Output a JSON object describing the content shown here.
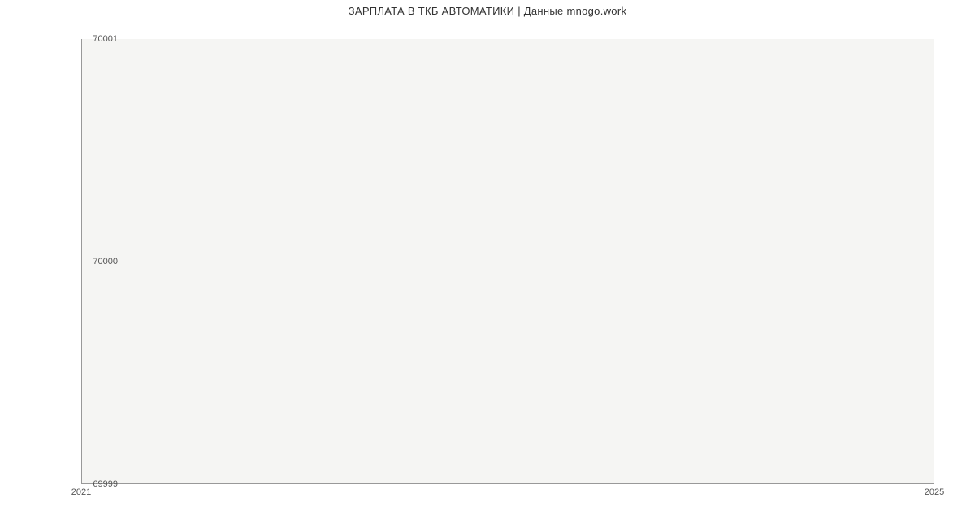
{
  "chart_data": {
    "type": "line",
    "title": "ЗАРПЛАТА В ТКБ АВТОМАТИКИ | Данные mnogo.work",
    "x": [
      2021,
      2025
    ],
    "values": [
      70000,
      70000
    ],
    "xlabel": "",
    "ylabel": "",
    "xlim": [
      2021,
      2025
    ],
    "ylim": [
      69999,
      70001
    ],
    "x_ticks": [
      {
        "label": "2021",
        "pos": 0
      },
      {
        "label": "2025",
        "pos": 1
      }
    ],
    "y_ticks": [
      {
        "label": "69999",
        "pos": 0
      },
      {
        "label": "70000",
        "pos": 0.5
      },
      {
        "label": "70001",
        "pos": 1
      }
    ],
    "line_color": "#4a7fd4"
  }
}
